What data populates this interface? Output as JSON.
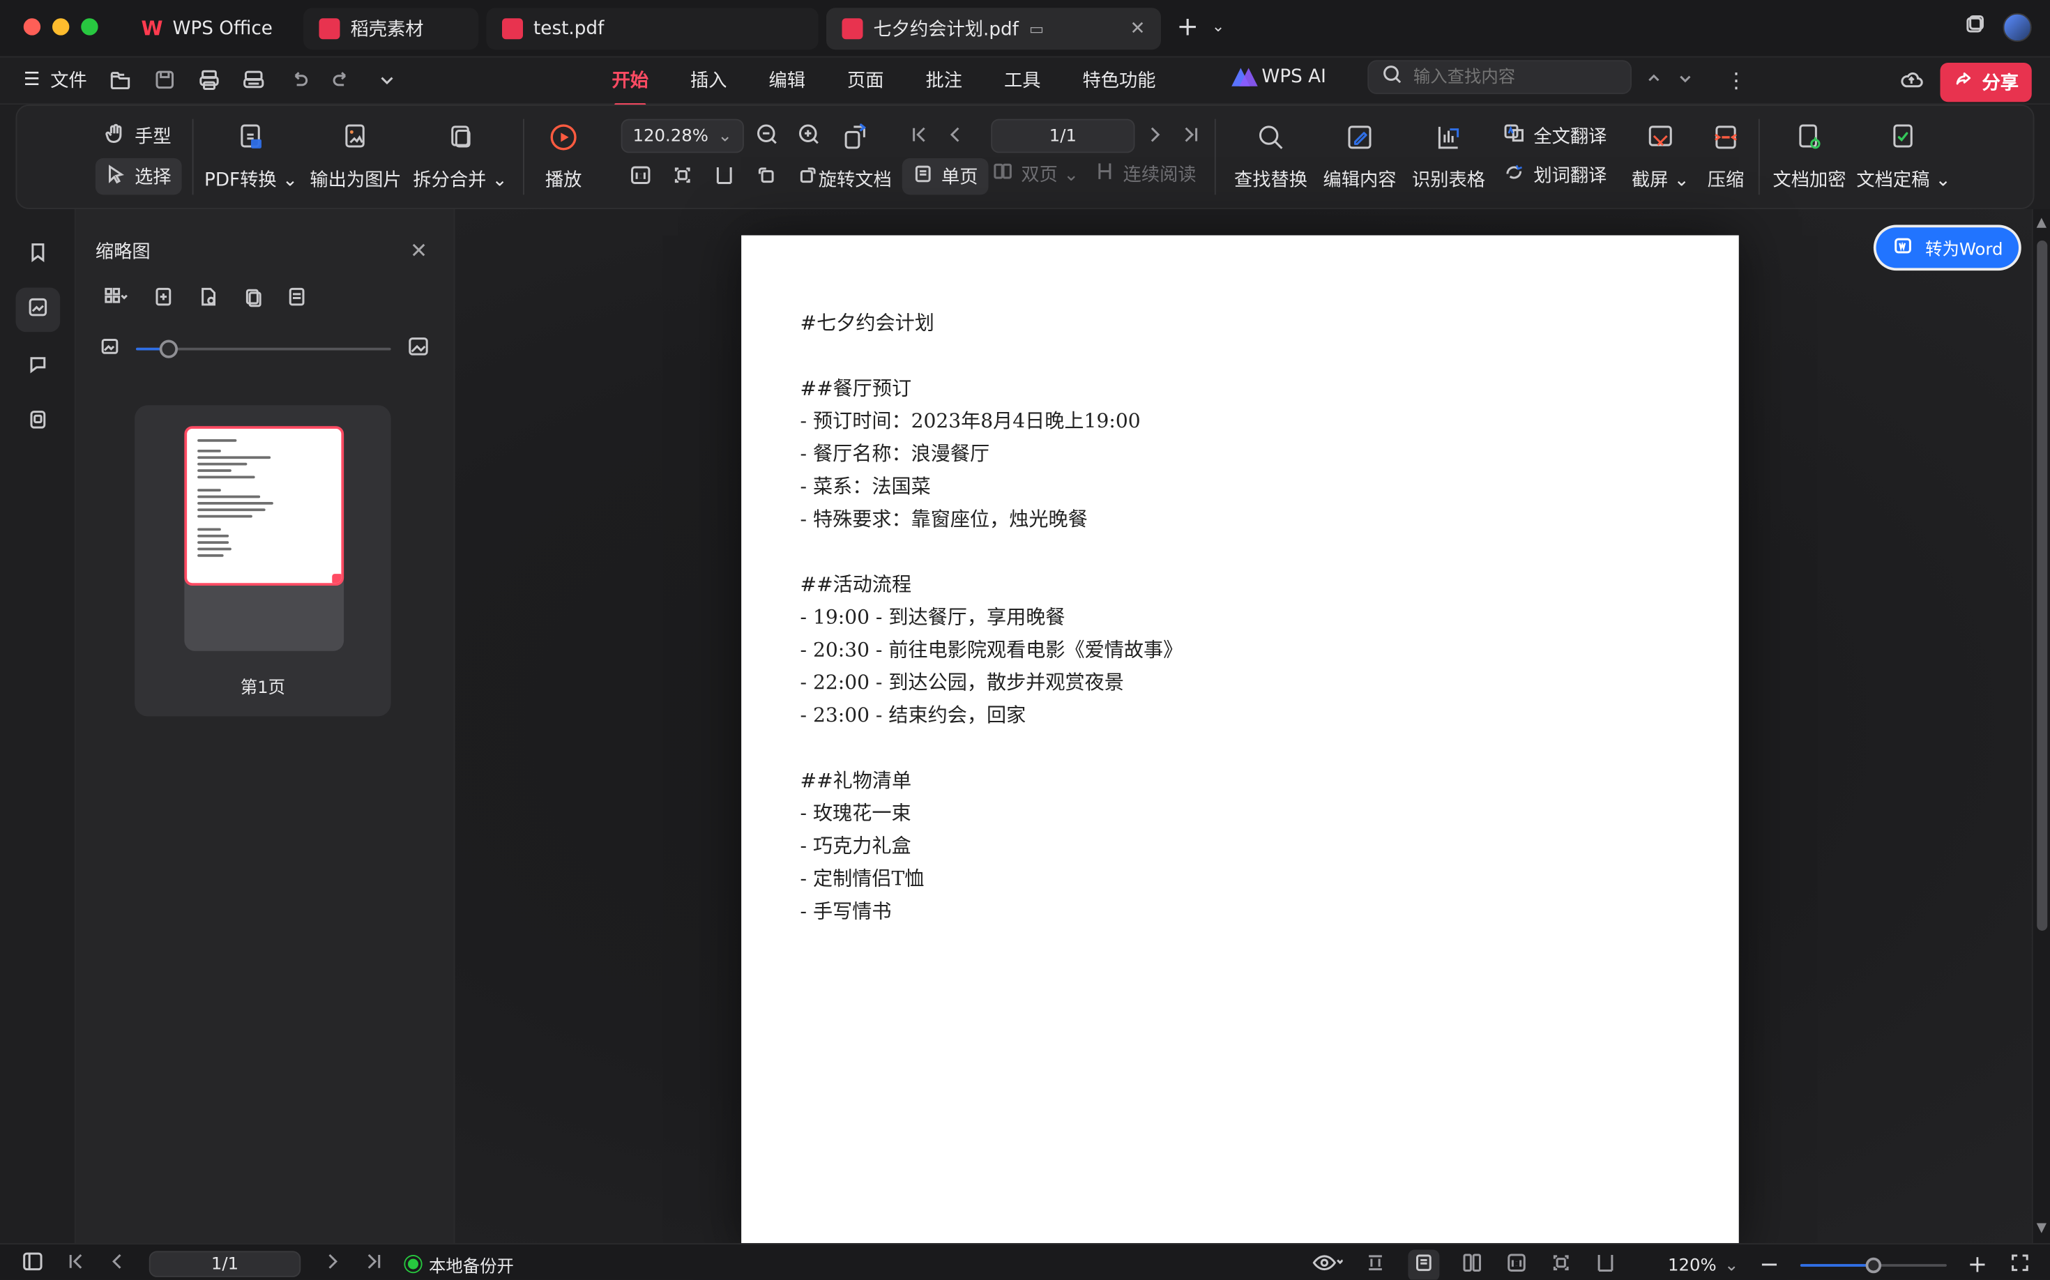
{
  "titlebar": {
    "tabs": [
      {
        "label": "WPS Office",
        "icon": "wps-logo-icon"
      },
      {
        "label": "稻壳素材",
        "icon": "docer-icon"
      },
      {
        "label": "test.pdf",
        "icon": "pdf-icon"
      },
      {
        "label": "七夕约会计划.pdf",
        "icon": "pdf-icon",
        "active": true
      }
    ]
  },
  "menubar": {
    "file_label": "文件",
    "tabs": [
      "开始",
      "插入",
      "编辑",
      "页面",
      "批注",
      "工具",
      "特色功能"
    ],
    "active_tab": "开始",
    "ai_label": "WPS AI",
    "search_placeholder": "输入查找内容",
    "share_label": "分享"
  },
  "ribbon": {
    "hand_label": "手型",
    "select_label": "选择",
    "pdf_convert_label": "PDF转换",
    "export_image_label": "输出为图片",
    "split_merge_label": "拆分合并",
    "play_label": "播放",
    "zoom_value": "120.28%",
    "rotate_doc_label": "旋转文档",
    "page_indicator": "1/1",
    "single_page_label": "单页",
    "double_page_label": "双页",
    "continuous_label": "连续阅读",
    "find_replace_label": "查找替换",
    "edit_content_label": "编辑内容",
    "recognize_table_label": "识别表格",
    "full_translate_label": "全文翻译",
    "word_translate_label": "划词翻译",
    "screenshot_label": "截屏",
    "compress_label": "压缩",
    "encrypt_label": "文档加密",
    "finalize_label": "文档定稿"
  },
  "sidebar": {
    "title": "缩略图",
    "thumbnail_slider": 0.13,
    "page_label": "第1页"
  },
  "document": {
    "convert_button": "转为Word",
    "lines": [
      "#七夕约会计划",
      "",
      "##餐厅预订",
      "- 预订时间：2023年8月4日晚上19:00",
      "- 餐厅名称：浪漫餐厅",
      "- 菜系：法国菜",
      "- 特殊要求：靠窗座位，烛光晚餐",
      "",
      "##活动流程",
      "- 19:00 - 到达餐厅，享用晚餐",
      "- 20:30 - 前往电影院观看电影《爱情故事》",
      "- 22:00 - 到达公园，散步并观赏夜景",
      "- 23:00 - 结束约会，回家",
      "",
      "##礼物清单",
      "- 玫瑰花一束",
      "- 巧克力礼盒",
      "- 定制情侣T恤",
      "- 手写情书"
    ]
  },
  "statusbar": {
    "page_indicator": "1/1",
    "backup_label": "本地备份开",
    "zoom_label": "120%",
    "zoom_level": 0.5
  },
  "colors": {
    "accent": "#e8334f",
    "active_tab": "#ff4b63",
    "blue": "#2174ff"
  }
}
